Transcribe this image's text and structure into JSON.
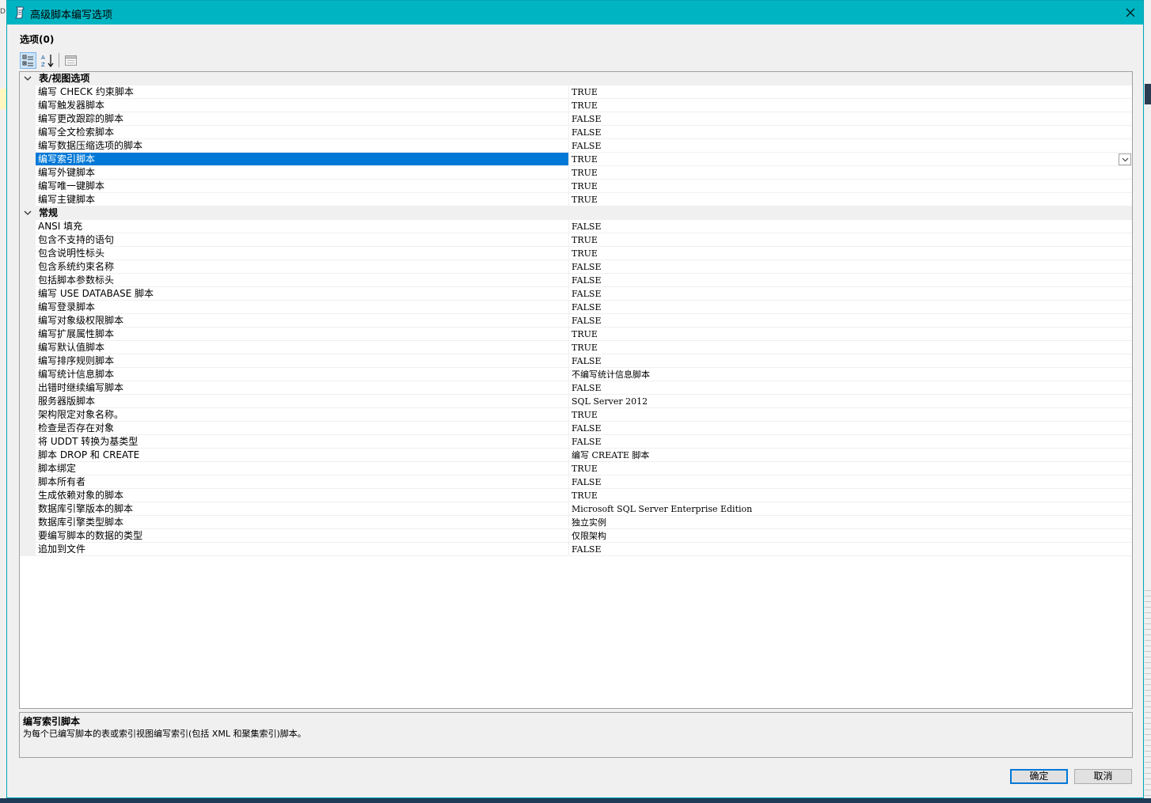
{
  "window": {
    "title": "高级脚本编写选项",
    "close_glyph": "✕"
  },
  "heading": "选项(0)",
  "categories": [
    {
      "label": "表/视图选项",
      "properties": [
        {
          "name": "编写 CHECK 约束脚本",
          "value": "TRUE"
        },
        {
          "name": "编写触发器脚本",
          "value": "TRUE"
        },
        {
          "name": "编写更改跟踪的脚本",
          "value": "FALSE"
        },
        {
          "name": "编写全文检索脚本",
          "value": "FALSE"
        },
        {
          "name": "编写数据压缩选项的脚本",
          "value": "FALSE"
        },
        {
          "name": "编写索引脚本",
          "value": "TRUE",
          "selected": true
        },
        {
          "name": "编写外键脚本",
          "value": "TRUE"
        },
        {
          "name": "编写唯一键脚本",
          "value": "TRUE"
        },
        {
          "name": "编写主键脚本",
          "value": "TRUE"
        }
      ]
    },
    {
      "label": "常规",
      "properties": [
        {
          "name": "ANSI 填充",
          "value": "FALSE"
        },
        {
          "name": "包含不支持的语句",
          "value": "TRUE"
        },
        {
          "name": "包含说明性标头",
          "value": "TRUE"
        },
        {
          "name": "包含系统约束名称",
          "value": "FALSE"
        },
        {
          "name": "包括脚本参数标头",
          "value": "FALSE"
        },
        {
          "name": "编写 USE DATABASE 脚本",
          "value": "FALSE"
        },
        {
          "name": "编写登录脚本",
          "value": "FALSE"
        },
        {
          "name": "编写对象级权限脚本",
          "value": "FALSE"
        },
        {
          "name": "编写扩展属性脚本",
          "value": "TRUE"
        },
        {
          "name": "编写默认值脚本",
          "value": "TRUE"
        },
        {
          "name": "编写排序规则脚本",
          "value": "FALSE"
        },
        {
          "name": "编写统计信息脚本",
          "value": "不编写统计信息脚本"
        },
        {
          "name": "出错时继续编写脚本",
          "value": "FALSE"
        },
        {
          "name": "服务器版脚本",
          "value": "SQL Server 2012"
        },
        {
          "name": "架构限定对象名称。",
          "value": "TRUE"
        },
        {
          "name": "检查是否存在对象",
          "value": "FALSE"
        },
        {
          "name": "将 UDDT 转换为基类型",
          "value": "FALSE"
        },
        {
          "name": "脚本 DROP 和 CREATE",
          "value": "编写 CREATE 脚本"
        },
        {
          "name": "脚本绑定",
          "value": "TRUE"
        },
        {
          "name": "脚本所有者",
          "value": "FALSE"
        },
        {
          "name": "生成依赖对象的脚本",
          "value": "TRUE"
        },
        {
          "name": "数据库引擎版本的脚本",
          "value": "Microsoft SQL Server Enterprise Edition"
        },
        {
          "name": "数据库引擎类型脚本",
          "value": "独立实例"
        },
        {
          "name": "要编写脚本的数据的类型",
          "value": "仅限架构"
        },
        {
          "name": "追加到文件",
          "value": "FALSE"
        }
      ]
    }
  ],
  "description": {
    "title": "编写索引脚本",
    "text": "为每个已编写脚本的表或索引视图编写索引(包括 XML 和聚集索引)脚本。"
  },
  "buttons": {
    "ok": "确定",
    "cancel": "取消"
  },
  "colors": {
    "titlebar": "#00b4c2",
    "selection": "#0078d7"
  },
  "icons": [
    "script-icon",
    "close-icon",
    "categorized-icon",
    "sort-alpha-icon",
    "property-pages-icon",
    "chevron-down-icon"
  ]
}
